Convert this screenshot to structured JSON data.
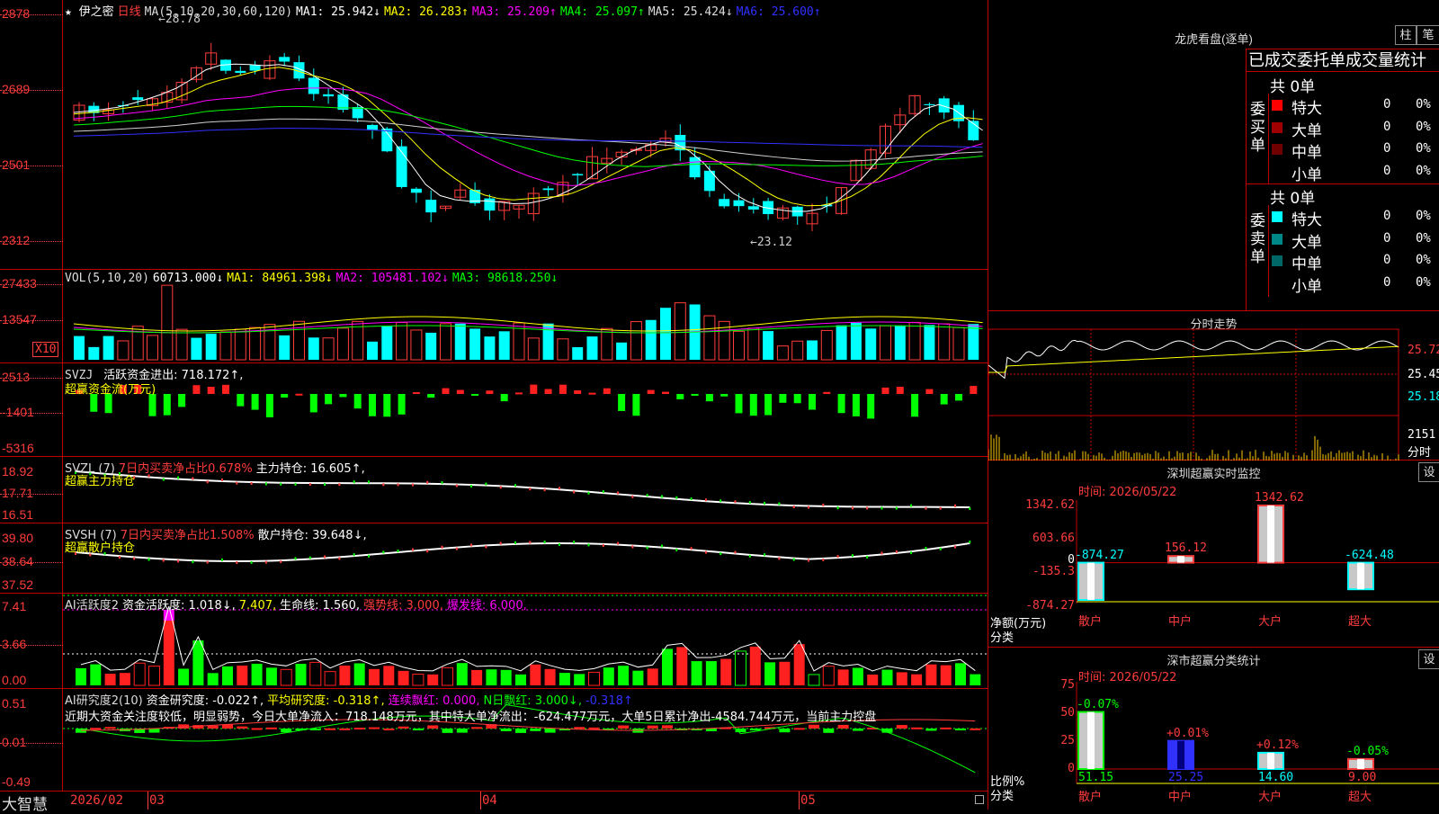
{
  "main": {
    "title": "★ 伊之密",
    "period": "日线",
    "ma_label": "MA(5,10,20,30,60,120)",
    "ma": [
      {
        "label": "MA1: 25.942↓",
        "color": "#ffffff"
      },
      {
        "label": "MA2: 26.283↑",
        "color": "#ffff00"
      },
      {
        "label": "MA3: 25.209↑",
        "color": "#ff00ff"
      },
      {
        "label": "MA4: 25.097↑",
        "color": "#00ff00"
      },
      {
        "label": "MA5: 25.424↓",
        "color": "#d0d0d0"
      },
      {
        "label": "MA6: 25.600↑",
        "color": "#3030ff"
      }
    ],
    "y_labels": [
      "2878",
      "2689",
      "2501",
      "2312"
    ],
    "high_marker": "28.78",
    "low_marker": "23.12"
  },
  "vol": {
    "header": "VOL(5,10,20)",
    "value": "60713.000↓",
    "ma1": "MA1: 84961.398↓",
    "ma2": "MA2: 105481.102↓",
    "ma3": "MA3: 98618.250↓",
    "y_labels": [
      "27433",
      "13547"
    ],
    "unit": "X10"
  },
  "svzj": {
    "header": "SVZJ",
    "item": "活跃资金进出: 718.172↑,",
    "subtitle": "超赢资金流(万元)",
    "y_labels": [
      "2513",
      "-1401",
      "-5316"
    ]
  },
  "svzl": {
    "header": "SVZL (7)",
    "item1": "7日内买卖净占比0.678%",
    "item2": "主力持仓: 16.605↑,",
    "subtitle": "超赢主力持仓",
    "y_labels": [
      "18.92",
      "17.71",
      "16.51"
    ]
  },
  "svsh": {
    "header": "SVSH (7)",
    "item1": "7日内买卖净占比1.508%",
    "item2": "散户持仓: 39.648↓,",
    "subtitle": "超赢散户持仓",
    "y_labels": [
      "39.80",
      "38.64",
      "37.52"
    ]
  },
  "ai_active": {
    "header": "AI活跃度2",
    "item1": "资金活跃度: 1.018↓,",
    "item2": "7.407,",
    "item3": "生命线: 1.560,",
    "item4": "强势线: 3.000,",
    "item5": "爆发线: 6.000,",
    "y_labels": [
      "7.41",
      "3.66",
      "0.00"
    ]
  },
  "ai_research": {
    "header": "AI研究度2(10)",
    "item1": "资金研究度: -0.022↑,",
    "item2": "平均研究度: -0.318↑,",
    "item3": "连续飘红: 0.000,",
    "item4": "N日飘红: 3.000↓,",
    "item5": "-0.318↑",
    "comment": "近期大资金关注度较低，明显弱势，今日大单净流入：718.148万元，其中特大单净流出：-624.477万元，大单5日累计净出-4584.744万元，当前主力控盘",
    "y_labels": [
      "0.51",
      "0.01",
      "-0.49"
    ]
  },
  "x_axis": {
    "brand": "大智慧",
    "labels": [
      "2026/02",
      "03",
      "04",
      "05"
    ]
  },
  "dragon": {
    "title": "龙虎看盘(逐单)",
    "btn1": "柱",
    "btn2": "笔",
    "subtitle": "已成交委托单成交量统计",
    "buy": {
      "side": "委买单",
      "total": "共 0单",
      "rows": [
        {
          "name": "特大",
          "v": "0",
          "p": "0%",
          "color": "#ff0000"
        },
        {
          "name": "大单",
          "v": "0",
          "p": "0%",
          "color": "#a00000"
        },
        {
          "name": "中单",
          "v": "0",
          "p": "0%",
          "color": "#700000"
        },
        {
          "name": "小单",
          "v": "0",
          "p": "0%",
          "color": "#000000"
        }
      ]
    },
    "sell": {
      "side": "委卖单",
      "total": "共 0单",
      "rows": [
        {
          "name": "特大",
          "v": "0",
          "p": "0%",
          "color": "#00ffff"
        },
        {
          "name": "大单",
          "v": "0",
          "p": "0%",
          "color": "#008888"
        },
        {
          "name": "中单",
          "v": "0",
          "p": "0%",
          "color": "#006666"
        },
        {
          "name": "小单",
          "v": "0",
          "p": "0%",
          "color": "#000000"
        }
      ]
    }
  },
  "minute": {
    "title": "分时走势",
    "y_labels": [
      "25.72",
      "25.45",
      "25.18"
    ],
    "vol_label": "2151",
    "vol_unit": "分时"
  },
  "sz_monitor": {
    "title": "深圳超赢实时监控",
    "btn": "设",
    "time": "时间: 2026/05/22",
    "y_labels": [
      "1342.62",
      "603.66",
      "-135.3",
      "-874.27"
    ],
    "y_zero": "0",
    "ylabel": "净额(万元)",
    "xlabel": "分类",
    "categories": [
      "散户",
      "中户",
      "大户",
      "超大"
    ],
    "values": [
      -874.27,
      156.12,
      1342.62,
      -624.48
    ],
    "value_labels": [
      "-874.27",
      "156.12",
      "1342.62",
      "-624.48"
    ]
  },
  "sz_class": {
    "title": "深市超赢分类统计",
    "btn": "设",
    "time": "时间: 2026/05/22",
    "y_labels": [
      "75",
      "50",
      "25",
      "0"
    ],
    "ylabel": "比例%",
    "xlabel": "分类",
    "categories": [
      "散户",
      "中户",
      "大户",
      "超大"
    ],
    "values": [
      51.15,
      25.25,
      14.6,
      9.0
    ],
    "value_labels": [
      "51.15",
      "25.25",
      "14.60",
      "9.00"
    ],
    "changes": [
      "-0.07%",
      "+0.01%",
      "+0.12%",
      "-0.05%"
    ]
  }
}
